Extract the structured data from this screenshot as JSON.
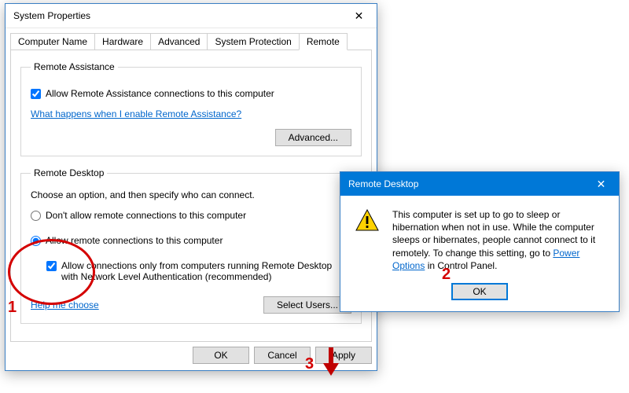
{
  "sysprops": {
    "title": "System Properties",
    "tabs": [
      "Computer Name",
      "Hardware",
      "Advanced",
      "System Protection",
      "Remote"
    ],
    "active_tab": 4,
    "ra": {
      "legend": "Remote Assistance",
      "allow_label": "Allow Remote Assistance connections to this computer",
      "allow_checked": true,
      "help_link": "What happens when I enable Remote Assistance?",
      "advanced_btn": "Advanced..."
    },
    "rd": {
      "legend": "Remote Desktop",
      "intro": "Choose an option, and then specify who can connect.",
      "opt_deny": "Don't allow remote connections to this computer",
      "opt_allow": "Allow remote connections to this computer",
      "nla_label": "Allow connections only from computers running Remote Desktop with Network Level Authentication (recommended)",
      "nla_checked": true,
      "selected": "allow",
      "help_link": "Help me choose",
      "select_users_btn": "Select Users..."
    },
    "buttons": {
      "ok": "OK",
      "cancel": "Cancel",
      "apply": "Apply"
    }
  },
  "msgbox": {
    "title": "Remote Desktop",
    "text_pre": "This computer is set up to go to sleep or hibernation when not in use. While the computer sleeps or hibernates, people cannot connect to it remotely. To change this setting, go to ",
    "power_link": "Power Options",
    "text_post": " in Control Panel.",
    "ok": "OK"
  },
  "annotations": {
    "n1": "1",
    "n2": "2",
    "n3": "3"
  }
}
